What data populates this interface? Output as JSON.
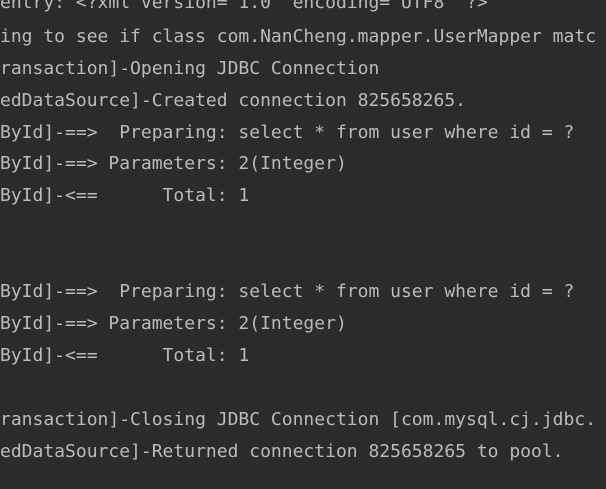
{
  "console": {
    "lines": [
      "entry: <?xml version=\"1.0\" encoding=\"UTF8\" ?>",
      "ing to see if class com.NanCheng.mapper.UserMapper matc",
      "ransaction]-Opening JDBC Connection",
      "edDataSource]-Created connection 825658265.",
      "ById]-==>  Preparing: select * from user where id = ?",
      "ById]-==> Parameters: 2(Integer)",
      "ById]-<==      Total: 1",
      "ById]-==>  Preparing: select * from user where id = ?",
      "ById]-==> Parameters: 2(Integer)",
      "ById]-<==      Total: 1",
      "ransaction]-Closing JDBC Connection [com.mysql.cj.jdbc.",
      "edDataSource]-Returned connection 825658265 to pool."
    ]
  }
}
